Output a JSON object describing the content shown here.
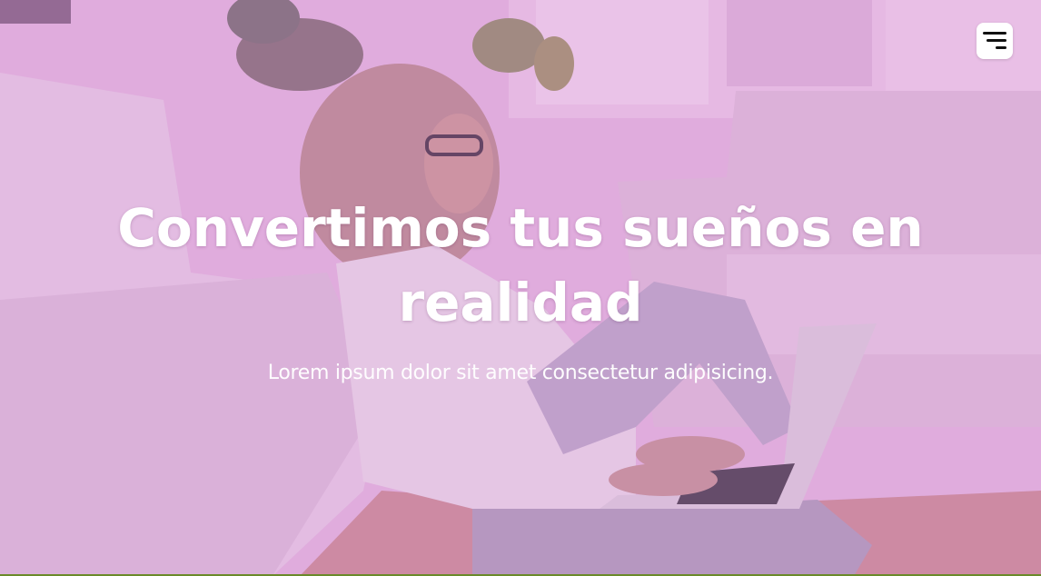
{
  "hero": {
    "title": "Convertimos tus sueños en realidad",
    "subtitle": "Lorem ipsum dolor sit amet consectetur adipisicing."
  },
  "menu": {
    "icon": "menu-icon"
  },
  "colors": {
    "overlay": "#d68cd6",
    "text": "#ffffff",
    "menu_bg": "#ffffff",
    "menu_icon": "#111111"
  }
}
